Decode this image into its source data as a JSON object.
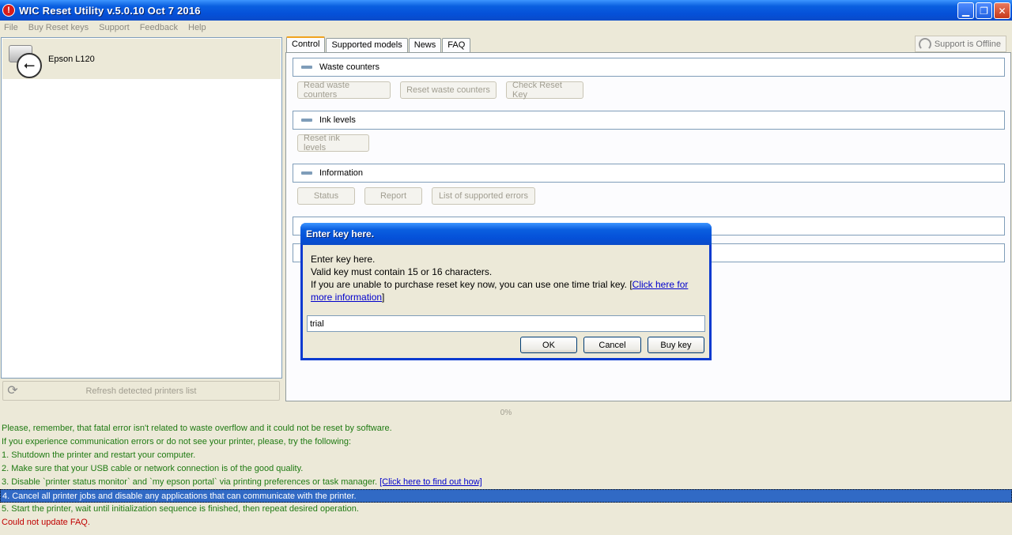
{
  "window": {
    "title": "WIC Reset Utility v.5.0.10 Oct  7 2016",
    "icon": "app-alert-icon",
    "icon_glyph": "!",
    "minimize": "▁",
    "maximize": "❐",
    "close": "✕"
  },
  "menu": [
    "File",
    "Buy Reset keys",
    "Support",
    "Feedback",
    "Help"
  ],
  "printers": [
    {
      "name": "Epson L120",
      "icon": "usb-printer-icon"
    }
  ],
  "usb_glyph": "⭠",
  "refresh_button": {
    "label": "Refresh detected printers list",
    "icon": "refresh-icon",
    "glyph": "⟳"
  },
  "tabs": [
    "Control",
    "Supported models",
    "News",
    "FAQ"
  ],
  "support_status": "Support is Offline",
  "groups": {
    "waste": {
      "label": "Waste counters",
      "buttons": [
        "Read waste counters",
        "Reset waste counters",
        "Check Reset Key"
      ]
    },
    "ink": {
      "label": "Ink levels",
      "buttons": [
        "Reset ink levels"
      ]
    },
    "info": {
      "label": "Information",
      "buttons": [
        "Status",
        "Report",
        "List of supported errors"
      ]
    }
  },
  "progress": {
    "label": "0%",
    "value": 0
  },
  "log": [
    {
      "text": "Please, remember, that fatal error isn't related to waste overflow and it could not be reset by software.",
      "type": "info"
    },
    {
      "text": "If you experience communication errors or do not see your printer, please, try the following:",
      "type": "info"
    },
    {
      "text": "1. Shutdown the printer and restart your computer.",
      "type": "info"
    },
    {
      "text": "2. Make sure that your USB cable or network connection is of the good quality.",
      "type": "info"
    },
    {
      "text": "3. Disable `printer status monitor` and `my epson portal` via printing preferences or task manager. ",
      "link": "[Click here to find out how]",
      "type": "info"
    },
    {
      "text": "4. Cancel all printer jobs and disable any applications that can communicate with the printer.",
      "type": "selected"
    },
    {
      "text": "5. Start the printer, wait until initialization sequence is finished, then repeat desired operation.",
      "type": "info"
    },
    {
      "text": "Could not update FAQ.",
      "type": "error"
    }
  ],
  "dialog": {
    "title": "Enter key here.",
    "line1": "Enter key here.",
    "line2": "Valid key must contain 15 or 16 characters.",
    "line3": "If you are unable to purchase reset key now, you can use one time trial key. [",
    "link": "Click here for more information",
    "line3_end": "]",
    "input_value": "trial",
    "ok": "OK",
    "cancel": "Cancel",
    "buy_key": "Buy key"
  }
}
